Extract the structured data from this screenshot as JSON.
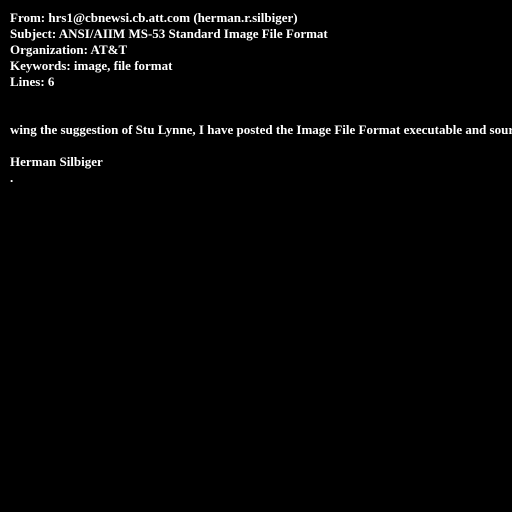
{
  "colors": {
    "background": "#000000",
    "text": "#ffffff"
  },
  "headers": {
    "from": "From: hrs1@cbnewsi.cb.att.com (herman.r.silbiger)",
    "subject": "Subject: ANSI/AIIM MS-53 Standard Image File Format",
    "organization": "Organization: AT&T",
    "keywords": "Keywords: image, file format",
    "lines": "Lines: 6"
  },
  "body": {
    "text": "wing the suggestion of Stu Lynne, I have posted the Image File Format executable and source"
  },
  "signature": {
    "name": "Herman Silbiger",
    "terminator": "."
  }
}
